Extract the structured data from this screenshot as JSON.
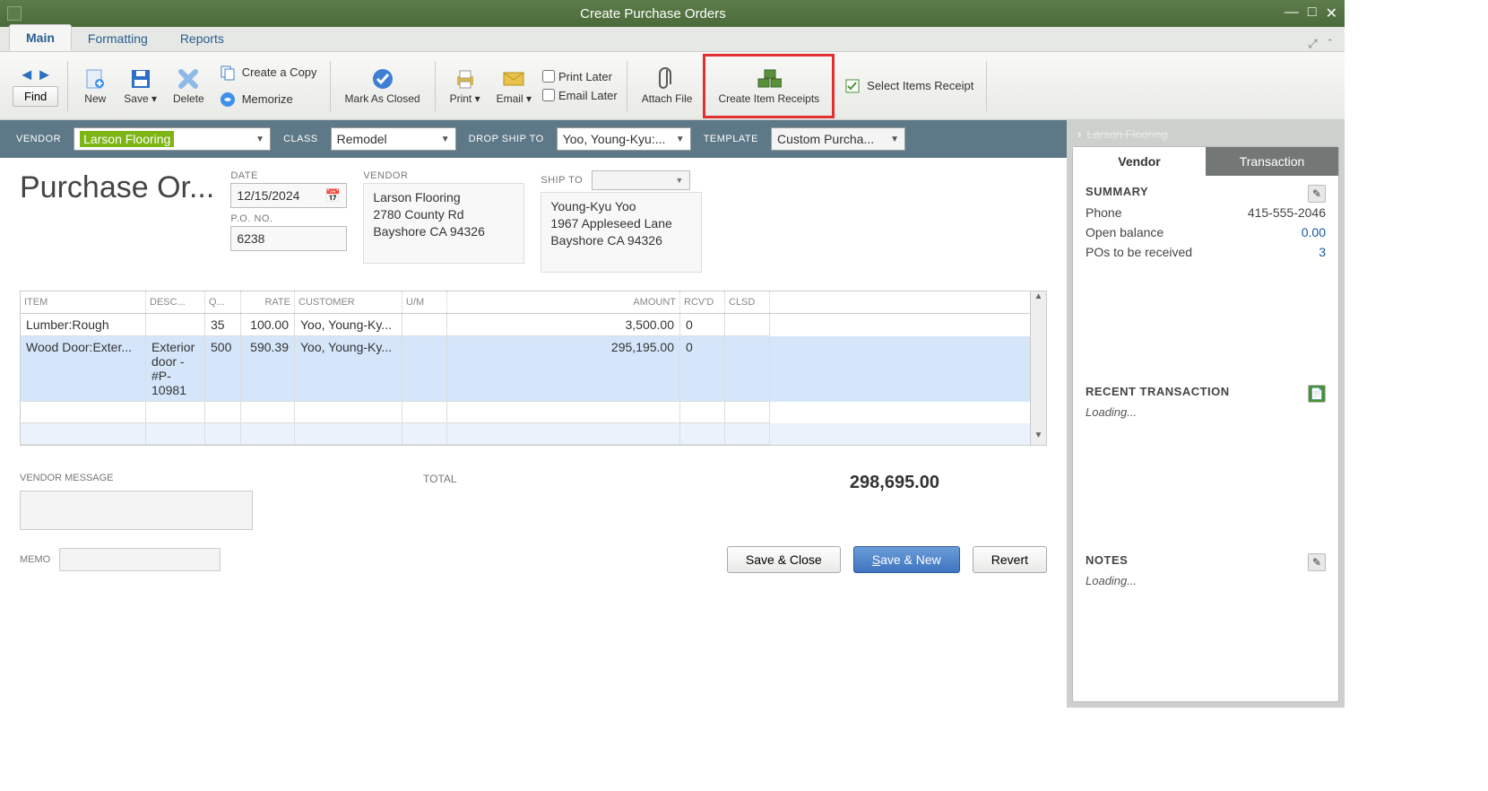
{
  "window": {
    "title": "Create Purchase Orders"
  },
  "tabs": {
    "main": "Main",
    "formatting": "Formatting",
    "reports": "Reports"
  },
  "toolbar": {
    "find": "Find",
    "new": "New",
    "save": "Save",
    "delete": "Delete",
    "create_copy": "Create a Copy",
    "memorize": "Memorize",
    "mark_closed": "Mark As Closed",
    "print": "Print",
    "email": "Email",
    "print_later": "Print Later",
    "email_later": "Email Later",
    "attach_file": "Attach File",
    "create_item_receipts": "Create Item Receipts",
    "select_items_receipt": "Select Items Receipt"
  },
  "header": {
    "vendor_lbl": "VENDOR",
    "vendor_val": "Larson Flooring",
    "class_lbl": "CLASS",
    "class_val": "Remodel",
    "dropship_lbl": "DROP SHIP TO",
    "dropship_val": "Yoo, Young-Kyu:...",
    "template_lbl": "TEMPLATE",
    "template_val": "Custom Purcha..."
  },
  "form": {
    "title": "Purchase Or...",
    "date_lbl": "DATE",
    "date": "12/15/2024",
    "pono_lbl": "P.O. NO.",
    "pono": "6238",
    "vendor_lbl": "VENDOR",
    "vendor_addr1": "Larson Flooring",
    "vendor_addr2": "2780 County Rd",
    "vendor_addr3": "Bayshore CA 94326",
    "shipto_lbl": "SHIP TO",
    "ship_addr1": "Young-Kyu Yoo",
    "ship_addr2": "1967 Appleseed Lane",
    "ship_addr3": "Bayshore CA 94326"
  },
  "cols": {
    "item": "ITEM",
    "desc": "DESC...",
    "qty": "Q...",
    "rate": "RATE",
    "customer": "CUSTOMER",
    "um": "U/M",
    "amount": "AMOUNT",
    "rcvd": "RCV'D",
    "clsd": "CLSD"
  },
  "lines": [
    {
      "item": "Lumber:Rough",
      "desc": "",
      "qty": "35",
      "rate": "100.00",
      "customer": "Yoo, Young-Ky...",
      "um": "",
      "amount": "3,500.00",
      "rcvd": "0",
      "clsd": ""
    },
    {
      "item": "Wood Door:Exter...",
      "desc": "Exterior door - #P-10981",
      "qty": "500",
      "rate": "590.39",
      "customer": "Yoo, Young-Ky...",
      "um": "",
      "amount": "295,195.00",
      "rcvd": "0",
      "clsd": ""
    }
  ],
  "totals": {
    "label": "TOTAL",
    "amount": "298,695.00"
  },
  "msg": {
    "vendor_msg_lbl": "VENDOR MESSAGE",
    "memo_lbl": "MEMO"
  },
  "buttons": {
    "save_close": "Save & Close",
    "save_new": "Save & New",
    "revert": "Revert"
  },
  "side": {
    "vendor_name": "Larson Flooring",
    "tab_vendor": "Vendor",
    "tab_trans": "Transaction",
    "summary": "SUMMARY",
    "recent": "RECENT TRANSACTION",
    "notes": "NOTES",
    "phone_lbl": "Phone",
    "phone": "415-555-2046",
    "openbal_lbl": "Open balance",
    "openbal": "0.00",
    "pos_lbl": "POs to be received",
    "pos": "3",
    "loading": "Loading..."
  }
}
